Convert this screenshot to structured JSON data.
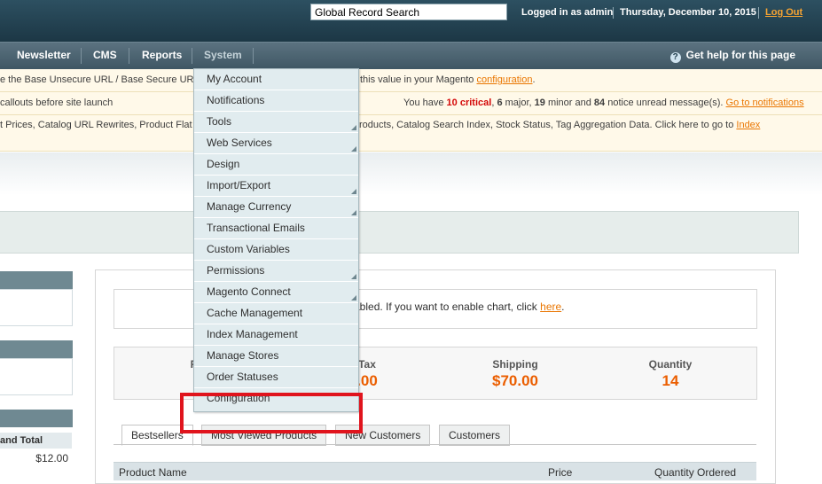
{
  "header": {
    "search_value": "Global Record Search",
    "logged_in": "Logged in as admin",
    "date": "Thursday, December 10, 2015",
    "logout": "Log Out"
  },
  "nav": {
    "items": [
      "Newsletter",
      "CMS",
      "Reports",
      "System"
    ],
    "help": "Get help for this page"
  },
  "notices": {
    "n1_prefix": "e the Base Unsecure URL / Base Secure UR",
    "n1_suffix": "this value in your Magento",
    "n1_link": "configuration",
    "n1_end": ".",
    "n2_left": "callouts before site launch",
    "n2_pre": "You have",
    "n2_critical": "10 critical",
    "n2_mid1": ", ",
    "n2_major": "6",
    "n2_mid2": " major, ",
    "n2_minor": "19",
    "n2_mid3": " minor and ",
    "n2_notice": "84",
    "n2_mid4": " notice unread message(s).",
    "n2_link": "Go to notifications",
    "n3_left": "t Prices, Catalog URL Rewrites, Product Flat",
    "n3_right": "roducts, Catalog Search Index, Stock Status, Tag Aggregation Data. Click here to go to",
    "n3_link": "Index"
  },
  "dashboard": {
    "chart_msg": "abled. If you want to enable chart, click",
    "chart_link": "here",
    "chart_end": ".",
    "totals": [
      {
        "label": "R",
        "value": ""
      },
      {
        "label": "Tax",
        "value": ".00"
      },
      {
        "label": "Shipping",
        "value": "$70.00"
      },
      {
        "label": "Quantity",
        "value": "14"
      }
    ],
    "tabs": [
      "Bestsellers",
      "Most Viewed Products",
      "New Customers",
      "Customers"
    ],
    "grid_cols": [
      "Product Name",
      "Price",
      "Quantity Ordered"
    ],
    "side_label": "and Total",
    "side_value": "$12.00"
  },
  "dropdown": {
    "items": [
      {
        "label": "My Account",
        "sub": false
      },
      {
        "label": "Notifications",
        "sub": false
      },
      {
        "label": "Tools",
        "sub": true
      },
      {
        "label": "Web Services",
        "sub": true
      },
      {
        "label": "Design",
        "sub": false
      },
      {
        "label": "Import/Export",
        "sub": true
      },
      {
        "label": "Manage Currency",
        "sub": true
      },
      {
        "label": "Transactional Emails",
        "sub": false
      },
      {
        "label": "Custom Variables",
        "sub": false
      },
      {
        "label": "Permissions",
        "sub": true
      },
      {
        "label": "Magento Connect",
        "sub": true
      },
      {
        "label": "Cache Management",
        "sub": false
      },
      {
        "label": "Index Management",
        "sub": false
      },
      {
        "label": "Manage Stores",
        "sub": false
      },
      {
        "label": "Order Statuses",
        "sub": false
      },
      {
        "label": "Configuration",
        "sub": false
      }
    ]
  },
  "colors": {
    "header_bg": "#22404f",
    "accent_orange": "#eb5e00",
    "highlight_red": "#e0141d"
  }
}
